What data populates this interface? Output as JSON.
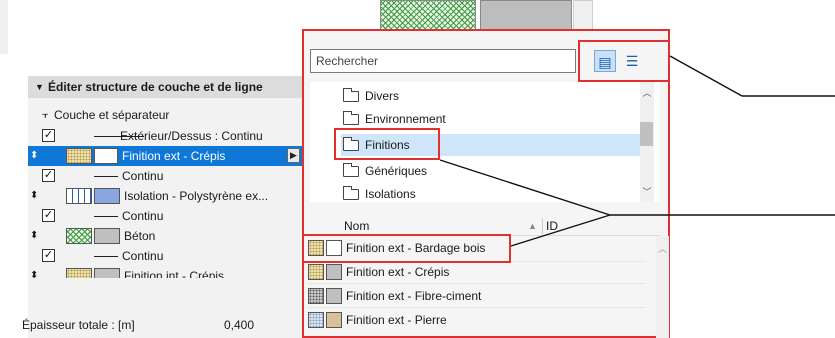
{
  "structure_panel": {
    "title": "Éditer structure de couche et de ligne",
    "column_header": "Couche et séparateur",
    "rows": [
      {
        "kind": "separator",
        "label": "Extérieur/Dessus : Continu",
        "checked": true
      },
      {
        "kind": "layer",
        "label": "Finition ext - Crépis",
        "selected": true
      },
      {
        "kind": "separator",
        "label": "Continu",
        "checked": true
      },
      {
        "kind": "layer",
        "label": "Isolation - Polystyrène ex..."
      },
      {
        "kind": "separator",
        "label": "Continu",
        "checked": true
      },
      {
        "kind": "layer",
        "label": "Béton"
      },
      {
        "kind": "separator",
        "label": "Continu",
        "checked": true
      },
      {
        "kind": "layer",
        "label": "Finition int - Crépis"
      }
    ],
    "total_label": "Épaisseur totale : [m]",
    "total_value": "0,400"
  },
  "browser": {
    "search_placeholder": "Rechercher",
    "folders": [
      "Divers",
      "Environnement",
      "Finitions",
      "Génériques",
      "Isolations"
    ],
    "selected_folder": "Finitions",
    "list_columns": {
      "name": "Nom",
      "id": "ID"
    },
    "items": [
      "Finition ext - Bardage bois",
      "Finition ext - Crépis",
      "Finition ext - Fibre-ciment",
      "Finition ext - Pierre"
    ]
  },
  "colors": {
    "selection_blue": "#0f78d7",
    "folder_selection": "#cfe5f9",
    "highlight_red": "#e03030"
  },
  "icons": [
    "folder-view-icon",
    "list-view-icon",
    "folder-icon",
    "checkbox-icon",
    "expand-triangle-icon",
    "drag-handle-icon",
    "scroll-up-icon",
    "scroll-down-icon"
  ]
}
